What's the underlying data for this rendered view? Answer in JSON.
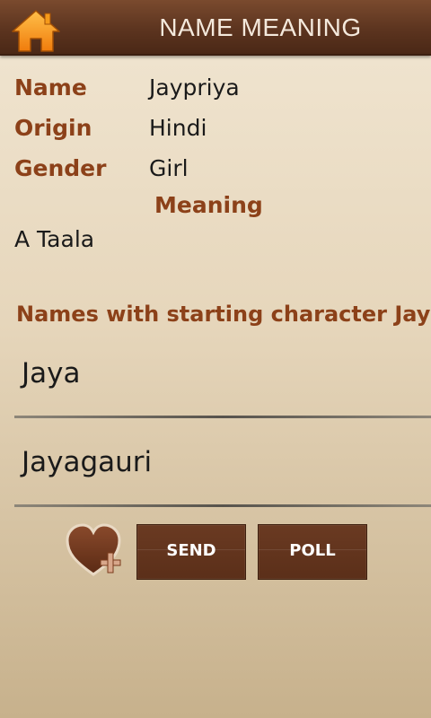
{
  "header": {
    "title": "NAME MEANING",
    "home_icon": "home-icon"
  },
  "details": {
    "name_label": "Name",
    "name_value": "Jaypriya",
    "origin_label": "Origin",
    "origin_value": "Hindi",
    "gender_label": "Gender",
    "gender_value": "Girl",
    "meaning_label": "Meaning",
    "meaning_value": "A Taala"
  },
  "related": {
    "heading": "Names with starting character Jay",
    "names": [
      "Jaya",
      "Jayagauri"
    ]
  },
  "actions": {
    "favorite_icon": "heart-add-icon",
    "send_label": "SEND",
    "poll_label": "POLL"
  },
  "colors": {
    "accent": "#8c4119",
    "bar": "#5c341f",
    "home": "#f59a1a"
  }
}
